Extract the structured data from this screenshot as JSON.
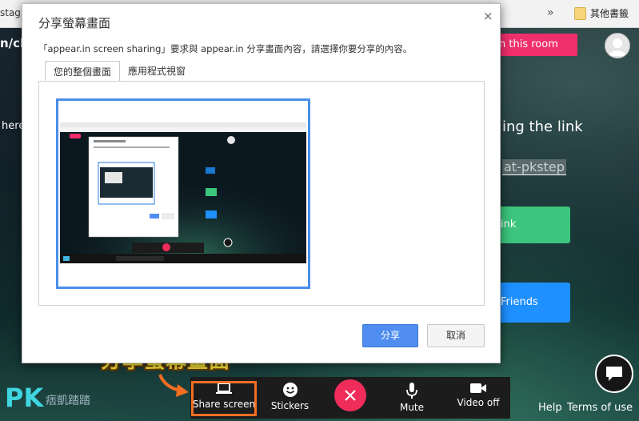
{
  "browser": {
    "tab_fragment": "stag",
    "bookmarks_label": "其他書籤",
    "chevron": "»"
  },
  "page": {
    "url_fragment": "n/ch",
    "here_fragment": "here",
    "join_label": "n this room",
    "sharing_link_text": "ing the link",
    "room_name": "at-pkstep",
    "green_button_label": "ink",
    "blue_button_label": "Friends"
  },
  "dialog": {
    "title": "分享螢幕畫面",
    "description": "「appear.in screen sharing」要求與 appear.in 分享畫面內容，請選擇你要分享的內容。",
    "tabs": [
      {
        "label": "您的整個畫面",
        "active": true
      },
      {
        "label": "應用程式視窗",
        "active": false
      }
    ],
    "share_label": "分享",
    "cancel_label": "取消",
    "close_glyph": "×"
  },
  "toolbar": {
    "items": [
      {
        "label": "Share screen",
        "icon": "laptop-icon"
      },
      {
        "label": "Stickers",
        "icon": "smiley-icon"
      },
      {
        "label": "Mute",
        "icon": "microphone-icon"
      },
      {
        "label": "Video off",
        "icon": "video-camera-icon"
      }
    ],
    "hangup_icon": "close-icon"
  },
  "footer": {
    "help": "Help",
    "terms": "Terms of use"
  },
  "annotation": {
    "text": "分享螢幕畫面"
  },
  "watermark": {
    "logo": "PK",
    "sub": "痞凱踏踏"
  },
  "colors": {
    "accent_blue": "#4f8ef0",
    "join_pink": "#ef2f6b",
    "green": "#3cc57c",
    "blue": "#1e90ff",
    "hangup_red": "#f02d5a",
    "highlight_orange": "#f26e22",
    "annotation_yellow": "#f7e43b"
  }
}
